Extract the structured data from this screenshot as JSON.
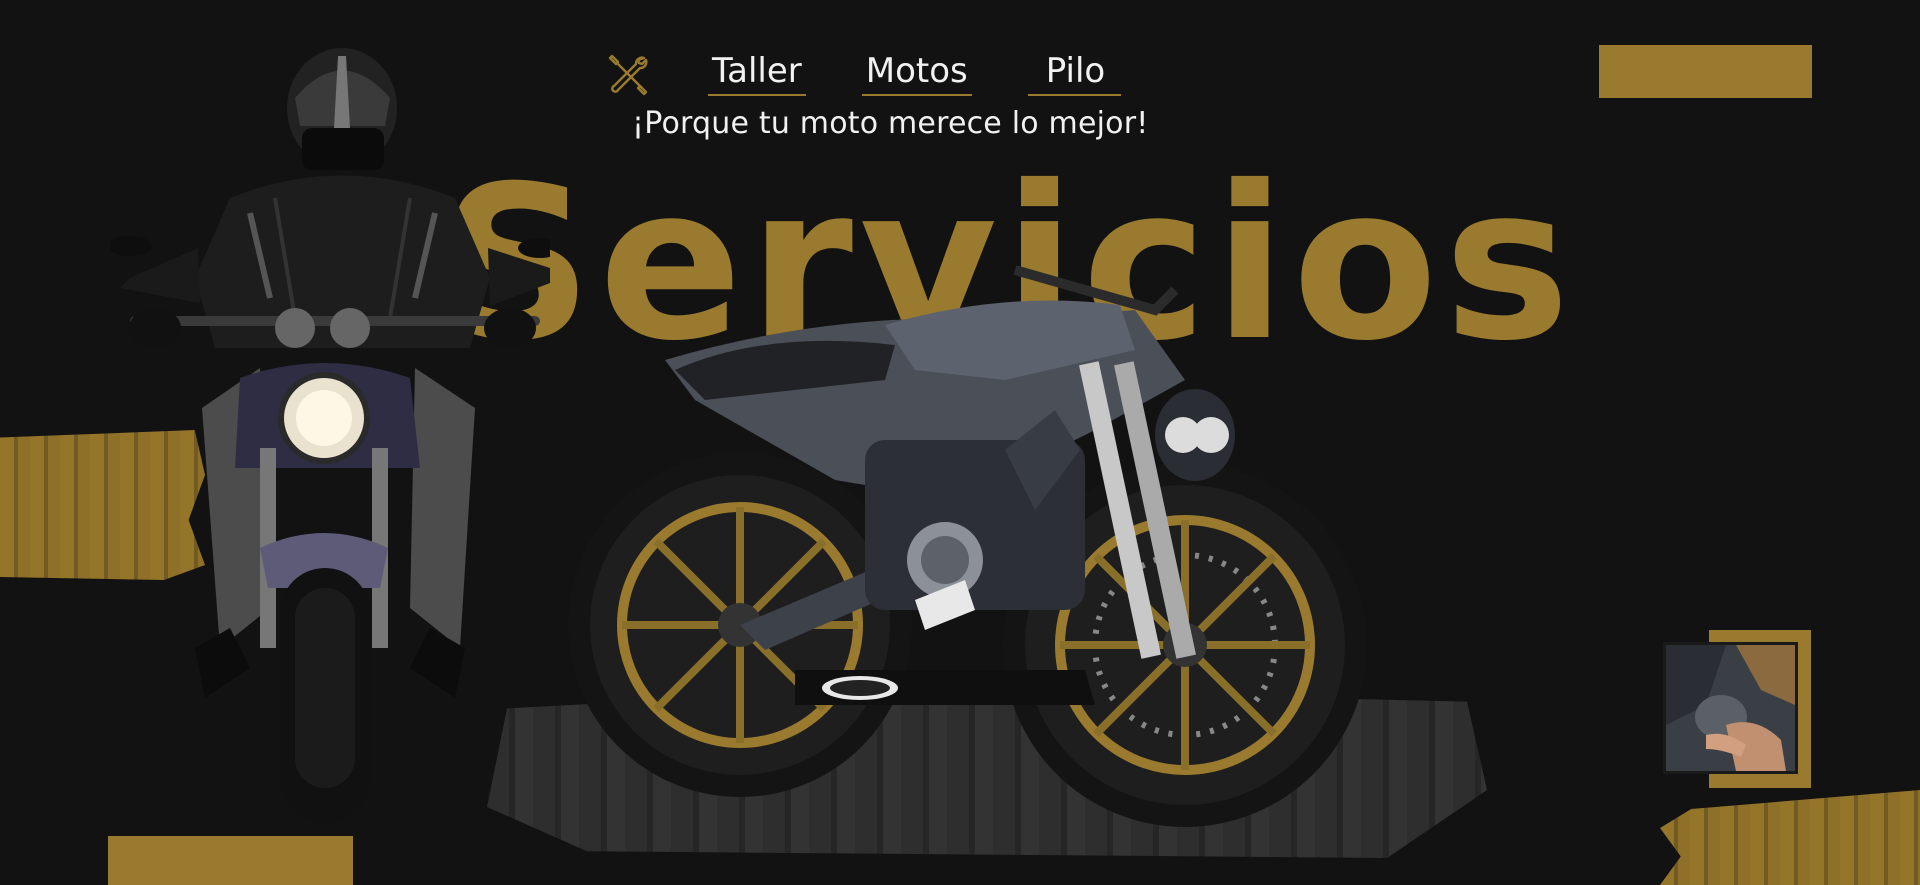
{
  "colors": {
    "background": "#121212",
    "accent_gold": "#9a7a2e",
    "text": "#f1f1f1"
  },
  "header": {
    "logo_icon": "wrench-screwdriver-icon",
    "nav": [
      {
        "label": "Taller"
      },
      {
        "label": "Motos"
      },
      {
        "label": "Pilo"
      }
    ],
    "tagline": "¡Porque tu moto merece lo mejor!"
  },
  "hero": {
    "title": "Servicios"
  },
  "images": {
    "rider": "rider-on-motorcycle",
    "bike": "naked-motorcycle",
    "thumb": "mechanic-working-thumbnail"
  }
}
